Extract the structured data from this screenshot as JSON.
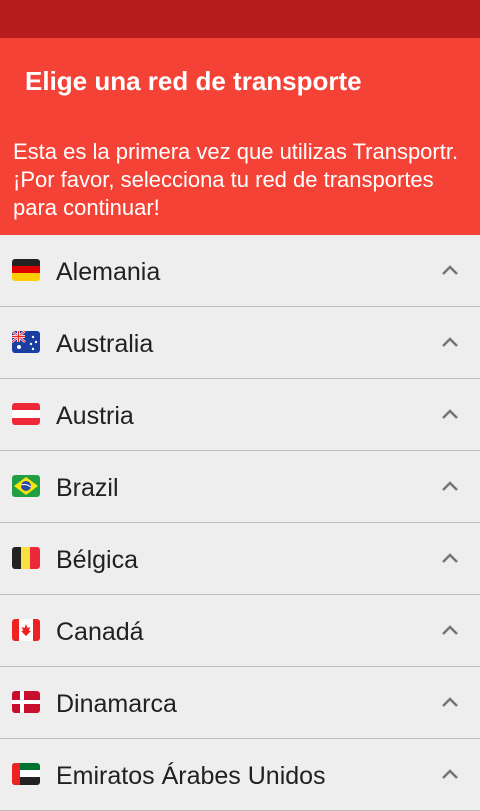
{
  "header": {
    "title": "Elige una red de transporte",
    "description": "Esta es la primera vez que utilizas Transportr. ¡Por favor, selecciona tu red de transportes para continuar!"
  },
  "countries": [
    {
      "name": "Alemania",
      "flag_icon": "germany-flag-icon"
    },
    {
      "name": "Australia",
      "flag_icon": "australia-flag-icon"
    },
    {
      "name": "Austria",
      "flag_icon": "austria-flag-icon"
    },
    {
      "name": "Brazil",
      "flag_icon": "brazil-flag-icon"
    },
    {
      "name": "Bélgica",
      "flag_icon": "belgium-flag-icon"
    },
    {
      "name": "Canadá",
      "flag_icon": "canada-flag-icon"
    },
    {
      "name": "Dinamarca",
      "flag_icon": "denmark-flag-icon"
    },
    {
      "name": "Emiratos Árabes Unidos",
      "flag_icon": "uae-flag-icon"
    }
  ],
  "colors": {
    "status_bar": "#b71c1c",
    "header": "#f44336",
    "list_background": "#eeeeee"
  }
}
